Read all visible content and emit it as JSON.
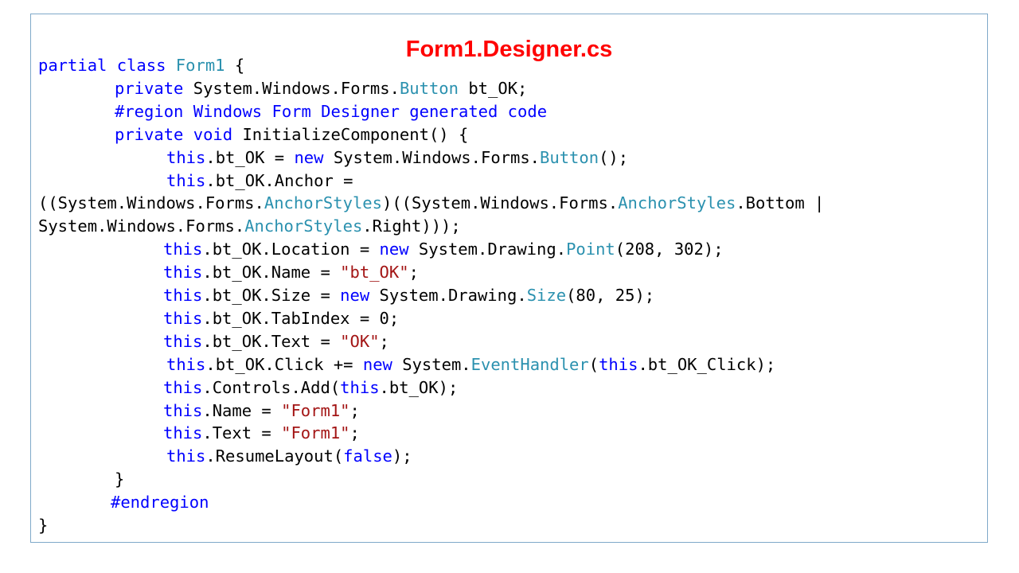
{
  "colors": {
    "title": "#ff0000",
    "plain": "#000000",
    "keyword": "#0000ff",
    "type": "#2b91af",
    "string": "#a31515",
    "border": "#7fa9c9"
  },
  "title": "Form1.Designer.cs",
  "code_lines": [
    {
      "tokens": [
        {
          "t": "partial class ",
          "k": "keyword"
        },
        {
          "t": "Form1",
          "k": "type"
        },
        {
          "t": " {",
          "k": "plain"
        }
      ]
    },
    {
      "tokens": [
        {
          "t": "private ",
          "k": "keyword"
        },
        {
          "t": "System.Windows.Forms.",
          "k": "plain"
        },
        {
          "t": "Button",
          "k": "type"
        },
        {
          "t": " bt_OK;",
          "k": "plain"
        }
      ]
    },
    {
      "tokens": [
        {
          "t": "#region Windows Form Designer generated code",
          "k": "keyword"
        }
      ]
    },
    {
      "tokens": [
        {
          "t": "private void ",
          "k": "keyword"
        },
        {
          "t": "InitializeComponent() {",
          "k": "plain"
        }
      ]
    },
    {
      "tokens": [
        {
          "t": "this",
          "k": "keyword"
        },
        {
          "t": ".bt_OK = ",
          "k": "plain"
        },
        {
          "t": "new ",
          "k": "keyword"
        },
        {
          "t": "System.Windows.Forms.",
          "k": "plain"
        },
        {
          "t": "Button",
          "k": "type"
        },
        {
          "t": "();",
          "k": "plain"
        }
      ]
    },
    {
      "tokens": [
        {
          "t": "this",
          "k": "keyword"
        },
        {
          "t": ".bt_OK.Anchor =",
          "k": "plain"
        }
      ]
    },
    {
      "tokens": [
        {
          "t": "((System.Windows.Forms.",
          "k": "plain"
        },
        {
          "t": "AnchorStyles",
          "k": "type"
        },
        {
          "t": ")((System.Windows.Forms.",
          "k": "plain"
        },
        {
          "t": "AnchorStyles",
          "k": "type"
        },
        {
          "t": ".Bottom |",
          "k": "plain"
        }
      ]
    },
    {
      "tokens": [
        {
          "t": "System.Windows.Forms.",
          "k": "plain"
        },
        {
          "t": "AnchorStyles",
          "k": "type"
        },
        {
          "t": ".Right)));",
          "k": "plain"
        }
      ]
    },
    {
      "tokens": [
        {
          "t": "this",
          "k": "keyword"
        },
        {
          "t": ".bt_OK.Location = ",
          "k": "plain"
        },
        {
          "t": "new ",
          "k": "keyword"
        },
        {
          "t": "System.Drawing.",
          "k": "plain"
        },
        {
          "t": "Point",
          "k": "type"
        },
        {
          "t": "(208, 302);",
          "k": "plain"
        }
      ]
    },
    {
      "tokens": [
        {
          "t": "this",
          "k": "keyword"
        },
        {
          "t": ".bt_OK.Name = ",
          "k": "plain"
        },
        {
          "t": "\"bt_OK\"",
          "k": "string"
        },
        {
          "t": ";",
          "k": "plain"
        }
      ]
    },
    {
      "tokens": [
        {
          "t": "this",
          "k": "keyword"
        },
        {
          "t": ".bt_OK.Size = ",
          "k": "plain"
        },
        {
          "t": "new ",
          "k": "keyword"
        },
        {
          "t": "System.Drawing.",
          "k": "plain"
        },
        {
          "t": "Size",
          "k": "type"
        },
        {
          "t": "(80, 25);",
          "k": "plain"
        }
      ]
    },
    {
      "tokens": [
        {
          "t": "this",
          "k": "keyword"
        },
        {
          "t": ".bt_OK.TabIndex = 0;",
          "k": "plain"
        }
      ]
    },
    {
      "tokens": [
        {
          "t": "this",
          "k": "keyword"
        },
        {
          "t": ".bt_OK.Text = ",
          "k": "plain"
        },
        {
          "t": "\"OK\"",
          "k": "string"
        },
        {
          "t": ";",
          "k": "plain"
        }
      ]
    },
    {
      "tokens": [
        {
          "t": "this",
          "k": "keyword"
        },
        {
          "t": ".bt_OK.Click += ",
          "k": "plain"
        },
        {
          "t": "new ",
          "k": "keyword"
        },
        {
          "t": "System.",
          "k": "plain"
        },
        {
          "t": "EventHandler",
          "k": "type"
        },
        {
          "t": "(",
          "k": "plain"
        },
        {
          "t": "this",
          "k": "keyword"
        },
        {
          "t": ".bt_OK_Click);",
          "k": "plain"
        }
      ]
    },
    {
      "tokens": [
        {
          "t": "this",
          "k": "keyword"
        },
        {
          "t": ".Controls.Add(",
          "k": "plain"
        },
        {
          "t": "this",
          "k": "keyword"
        },
        {
          "t": ".bt_OK);",
          "k": "plain"
        }
      ]
    },
    {
      "tokens": [
        {
          "t": "this",
          "k": "keyword"
        },
        {
          "t": ".Name = ",
          "k": "plain"
        },
        {
          "t": "\"Form1\"",
          "k": "string"
        },
        {
          "t": ";",
          "k": "plain"
        }
      ]
    },
    {
      "tokens": [
        {
          "t": "this",
          "k": "keyword"
        },
        {
          "t": ".Text = ",
          "k": "plain"
        },
        {
          "t": "\"Form1\"",
          "k": "string"
        },
        {
          "t": ";",
          "k": "plain"
        }
      ]
    },
    {
      "tokens": [
        {
          "t": "this",
          "k": "keyword"
        },
        {
          "t": ".ResumeLayout(",
          "k": "plain"
        },
        {
          "t": "false",
          "k": "keyword"
        },
        {
          "t": ");",
          "k": "plain"
        }
      ]
    },
    {
      "tokens": [
        {
          "t": "}",
          "k": "plain"
        }
      ]
    },
    {
      "tokens": [
        {
          "t": "#endregion",
          "k": "keyword"
        }
      ]
    },
    {
      "tokens": [
        {
          "t": "}",
          "k": "plain"
        }
      ]
    }
  ]
}
